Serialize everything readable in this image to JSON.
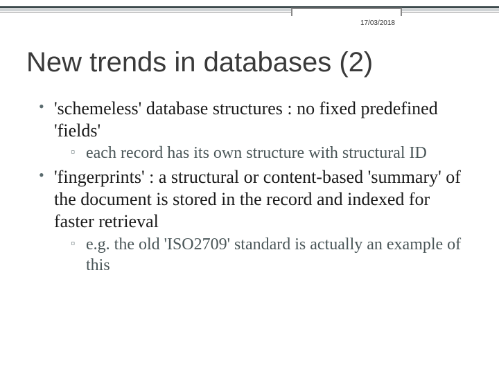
{
  "date": "17/03/2018",
  "title": "New trends in databases (2)",
  "bullets": [
    {
      "text": "'schemeless' database structures : no fixed predefined 'fields'",
      "sub": [
        "each record has its own structure with structural ID"
      ]
    },
    {
      "text": "'fingerprints' : a structural or content-based 'summary' of the document is stored in the record and indexed for faster retrieval",
      "sub": [
        "e.g. the old 'ISO2709' standard is actually an example of this"
      ]
    }
  ]
}
